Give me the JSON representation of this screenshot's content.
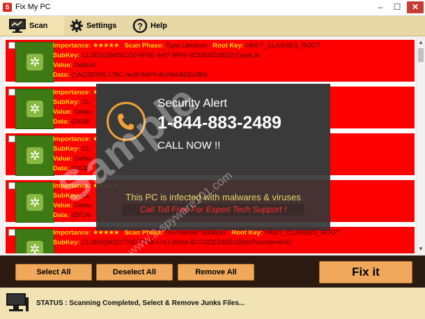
{
  "window": {
    "title": "Fix My PC",
    "app_icon_letter": "S"
  },
  "toolbar": {
    "scan": "Scan",
    "settings": "Settings",
    "help": "Help"
  },
  "rows": [
    {
      "importance_label": "Importance:",
      "stars": "★★★★★",
      "phase_label": "Scan Phase:",
      "phase": "Type Libraries",
      "rootkey_label": "Root Key:",
      "rootkey": "HKEY_CLASSES_ROOT",
      "subkey_label": "SubKey:",
      "subkey": "CLSID\\{24800CD0-0F4E-4df7-9F69-3C5903C8922}\\TypeLib",
      "value_label": "Value:",
      "value": "Default",
      "data_label": "Data:",
      "data": "{1AC8E958-179C-4e9f-B4F0-80A5A4B33486}"
    },
    {
      "importance_label": "Importance:",
      "stars": "★★★★★",
      "phase_label": "",
      "phase": "",
      "rootkey_label": "",
      "rootkey": "",
      "subkey_label": "SubKey:",
      "subkey": "CL",
      "value_label": "Value:",
      "value": "Defau",
      "data_label": "Data:",
      "data": "{D63E"
    },
    {
      "importance_label": "Importance:",
      "stars": "★★★★★",
      "phase_label": "",
      "phase": "",
      "rootkey_label": "",
      "rootkey": "",
      "subkey_label": "SubKey:",
      "subkey": "CL",
      "value_label": "Value:",
      "value": "Defau",
      "data_label": "Data:",
      "data": "{D63E"
    },
    {
      "importance_label": "Importance:",
      "stars": "★★★★★",
      "phase_label": "",
      "phase": "",
      "rootkey_label": "",
      "rootkey": "",
      "subkey_label": "SubKey:",
      "subkey": "CL",
      "value_label": "Value:",
      "value": "Defau",
      "data_label": "Data:",
      "data": "{DFD6"
    },
    {
      "importance_label": "Importance:",
      "stars": "★★★★★",
      "phase_label": "Scan Phase:",
      "phase": "ProcServer Subkeys",
      "rootkey_label": "Root Key:",
      "rootkey": "HKEY_CLASSES_ROOT",
      "subkey_label": "SubKey:",
      "subkey": "CLSID\\{343D770D-7788-47c2-B62A-B7C4CED925CB}\\InProcServer32",
      "value_label": "",
      "value": "",
      "data_label": "",
      "data": ""
    }
  ],
  "actions": {
    "select_all": "Select All",
    "deselect_all": "Deselect All",
    "remove_all": "Remove All",
    "fix_it": "Fix it"
  },
  "status": {
    "text": "STATUS : Scanning Completed, Select & Remove Junks Files..."
  },
  "popup": {
    "title": "Security Alert",
    "phone": "1-844-883-2489",
    "call": "CALL NOW !!",
    "infected": "This PC is infected with malwares & viruses",
    "tollfree": "Call Toll Free  For Expert Tech Support !"
  },
  "watermark": {
    "text": "Sample",
    "url": "www.2-spyware101.com"
  },
  "colors": {
    "row_bg": "#ff0000",
    "label": "#ffd400",
    "accent": "#f0a85c",
    "toolbar": "#e8d8a6"
  }
}
